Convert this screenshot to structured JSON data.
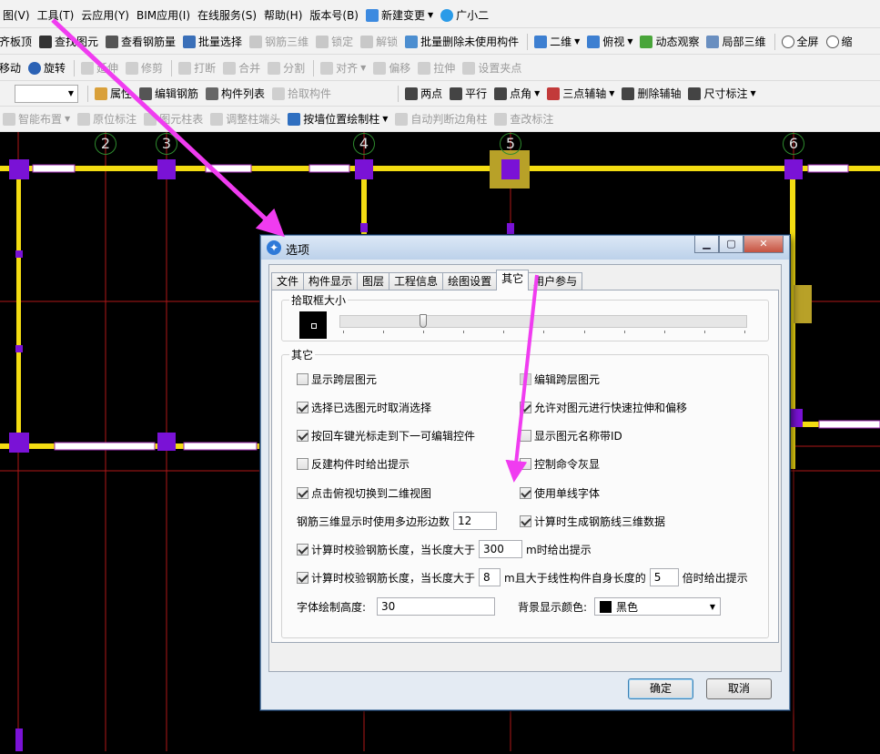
{
  "menu": [
    "图(V)",
    "工具(T)",
    "云应用(Y)",
    "BIM应用(I)",
    "在线服务(S)",
    "帮助(H)",
    "版本号(B)"
  ],
  "menu_extra": {
    "new_change": "新建变更",
    "assistant": "广小二"
  },
  "toolbar1": [
    "齐板顶",
    "查找图元",
    "查看钢筋量",
    "批量选择",
    "钢筋三维",
    "锁定",
    "解锁",
    "批量删除未使用构件"
  ],
  "view": {
    "mode": "二维",
    "angle": "俯视",
    "orbit": "动态观察",
    "local3d": "局部三维",
    "fullscreen": "全屏",
    "zoom": "缩"
  },
  "toolbar2": [
    "移动",
    "旋转",
    "延伸",
    "修剪",
    "打断",
    "合并",
    "分割",
    "对齐",
    "偏移",
    "拉伸",
    "设置夹点"
  ],
  "toolbar3": [
    "属性",
    "编辑钢筋",
    "构件列表",
    "拾取构件"
  ],
  "toolbar3_right": [
    "两点",
    "平行",
    "点角",
    "三点辅轴",
    "删除辅轴",
    "尺寸标注"
  ],
  "toolbar4": [
    "智能布置",
    "原位标注",
    "图元柱表",
    "调整柱端头",
    "按墙位置绘制柱",
    "自动判断边角柱",
    "查改标注"
  ],
  "axes": [
    "2",
    "3",
    "4",
    "5",
    "6"
  ],
  "dialog": {
    "title": "选项",
    "tabs": [
      "文件",
      "构件显示",
      "图层",
      "工程信息",
      "绘图设置",
      "其它",
      "用户参与"
    ],
    "pick_group": "拾取框大小",
    "pick_slider_fraction": 0.2,
    "other_group": "其它",
    "options_left": [
      {
        "label": "显示跨层图元",
        "checked": false
      },
      {
        "label": "选择已选图元时取消选择",
        "checked": true
      },
      {
        "label": "按回车键光标走到下一可编辑控件",
        "checked": true
      },
      {
        "label": "反建构件时给出提示",
        "checked": false
      },
      {
        "label": "点击俯视切换到二维视图",
        "checked": true
      }
    ],
    "options_right": [
      {
        "label": "编辑跨层图元",
        "checked": false
      },
      {
        "label": "允许对图元进行快速拉伸和偏移",
        "checked": true
      },
      {
        "label": "显示图元名称带ID",
        "checked": false
      },
      {
        "label": "控制命令灰显",
        "checked": false
      },
      {
        "label": "使用单线字体",
        "checked": true
      }
    ],
    "polygon_edges_label": "钢筋三维显示时使用多边形边数",
    "polygon_edges_value": "12",
    "gen_rebar_3d": {
      "label": "计算时生成钢筋线三维数据",
      "checked": true
    },
    "check_len1": {
      "prefix": "计算时校验钢筋长度，当长度大于",
      "value": "300",
      "suffix": "m时给出提示",
      "checked": true
    },
    "check_len2": {
      "prefix": "计算时校验钢筋长度，当长度大于",
      "value": "8",
      "mid": "m且大于线性构件自身长度的",
      "value2": "5",
      "suffix": "倍时给出提示",
      "checked": true
    },
    "font_height_label": "字体绘制高度:",
    "font_height_value": "30",
    "bg_color_label": "背景显示颜色:",
    "bg_color_value": "黑色",
    "ok": "确定",
    "cancel": "取消"
  },
  "colors": {
    "accent_arrow": "#f03cf0",
    "beam": "#f3dc12",
    "column": "#7a12d6",
    "grid_red": "#b01818",
    "canvas": "#000000"
  }
}
